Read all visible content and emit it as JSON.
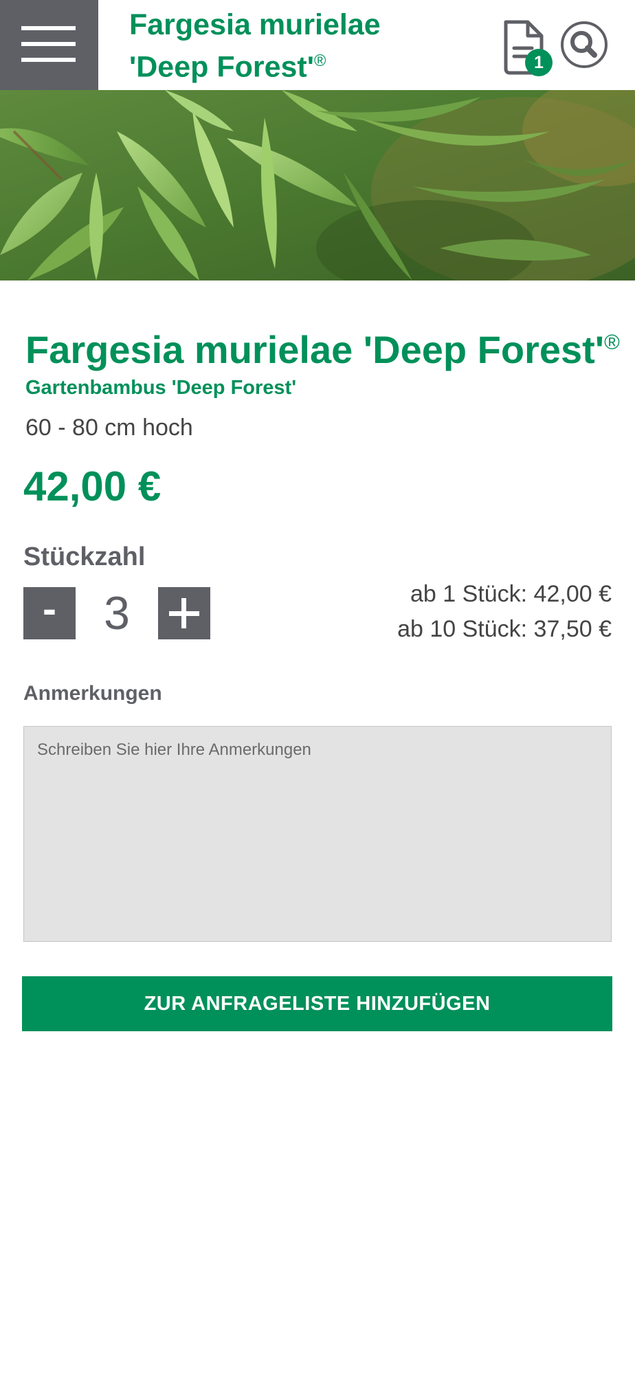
{
  "header": {
    "title_line1": "Fargesia murielae",
    "title_line2": "'Deep Forest'",
    "title_mark": "®",
    "cart_count": "1",
    "menu_icon": "hamburger-menu-icon",
    "cart_icon": "document-icon",
    "search_icon": "search-icon"
  },
  "hero": {
    "image": "bamboo-leaves-photo"
  },
  "product": {
    "title": "Fargesia murielae 'Deep Forest'",
    "title_mark": "®",
    "subtitle": "Gartenbambus 'Deep Forest'",
    "height": "60 - 80 cm hoch",
    "price": "42,00 €"
  },
  "quantity": {
    "label": "Stückzahl",
    "minus_label": "-",
    "value": "3",
    "tiers": [
      "ab 1 Stück: 42,00 €",
      "ab 10 Stück: 37,50 €"
    ]
  },
  "notes": {
    "label": "Anmerkungen",
    "placeholder": "Schreiben Sie hier Ihre Anmerkungen",
    "value": ""
  },
  "submit_label": "ZUR ANFRAGELISTE HINZUFÜGEN",
  "colors": {
    "brand_green": "#00905a",
    "dark_gray": "#5f6066",
    "textarea_bg": "#e3e3e3"
  }
}
